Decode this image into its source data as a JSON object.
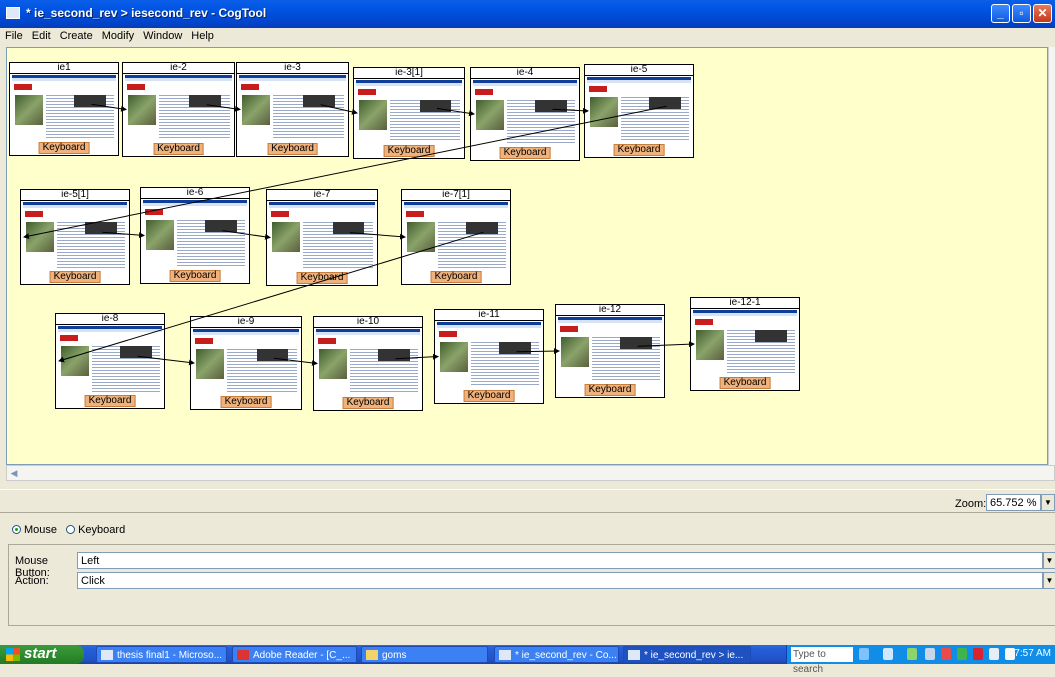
{
  "window": {
    "title": "* ie_second_rev > iesecond_rev - CogTool"
  },
  "menu": [
    "File",
    "Edit",
    "Create",
    "Modify",
    "Window",
    "Help"
  ],
  "frames": [
    {
      "name": "ie1",
      "button": "Keyboard"
    },
    {
      "name": "ie-2",
      "button": "Keyboard"
    },
    {
      "name": "ie-3",
      "button": "Keyboard"
    },
    {
      "name": "ie-3[1]",
      "button": "Keyboard"
    },
    {
      "name": "ie-4",
      "button": "Keyboard"
    },
    {
      "name": "ie-5",
      "button": "Keyboard"
    },
    {
      "name": "ie-5[1]",
      "button": "Keyboard"
    },
    {
      "name": "ie-6",
      "button": "Keyboard"
    },
    {
      "name": "ie-7",
      "button": "Keyboard"
    },
    {
      "name": "ie-7[1]",
      "button": "Keyboard"
    },
    {
      "name": "ie-8",
      "button": "Keyboard"
    },
    {
      "name": "ie-9",
      "button": "Keyboard"
    },
    {
      "name": "ie-10",
      "button": "Keyboard"
    },
    {
      "name": "ie-11",
      "button": "Keyboard"
    },
    {
      "name": "ie-12",
      "button": "Keyboard"
    },
    {
      "name": "ie-12-1",
      "button": "Keyboard"
    }
  ],
  "zoom": {
    "label": "Zoom:",
    "value": "65.752 %"
  },
  "device": {
    "mouse": "Mouse",
    "keyboard": "Keyboard",
    "selected": "Mouse"
  },
  "properties": {
    "mouse_button_label": "Mouse Button:",
    "mouse_button_value": "Left",
    "action_label": "Action:",
    "action_value": "Click"
  },
  "taskbar": {
    "start": "start",
    "tasks": [
      "thesis final1 - Microso...",
      "Adobe Reader - [C_...",
      "goms",
      "* ie_second_rev - Co...",
      "* ie_second_rev > ie..."
    ],
    "search_placeholder": "Type to search",
    "clock": "7:57 AM"
  },
  "colors": {
    "canvas": "#ffffcc",
    "keyboard_button": "#f0b27c",
    "titlebar": "#0055e5",
    "taskbar": "#245edb"
  }
}
